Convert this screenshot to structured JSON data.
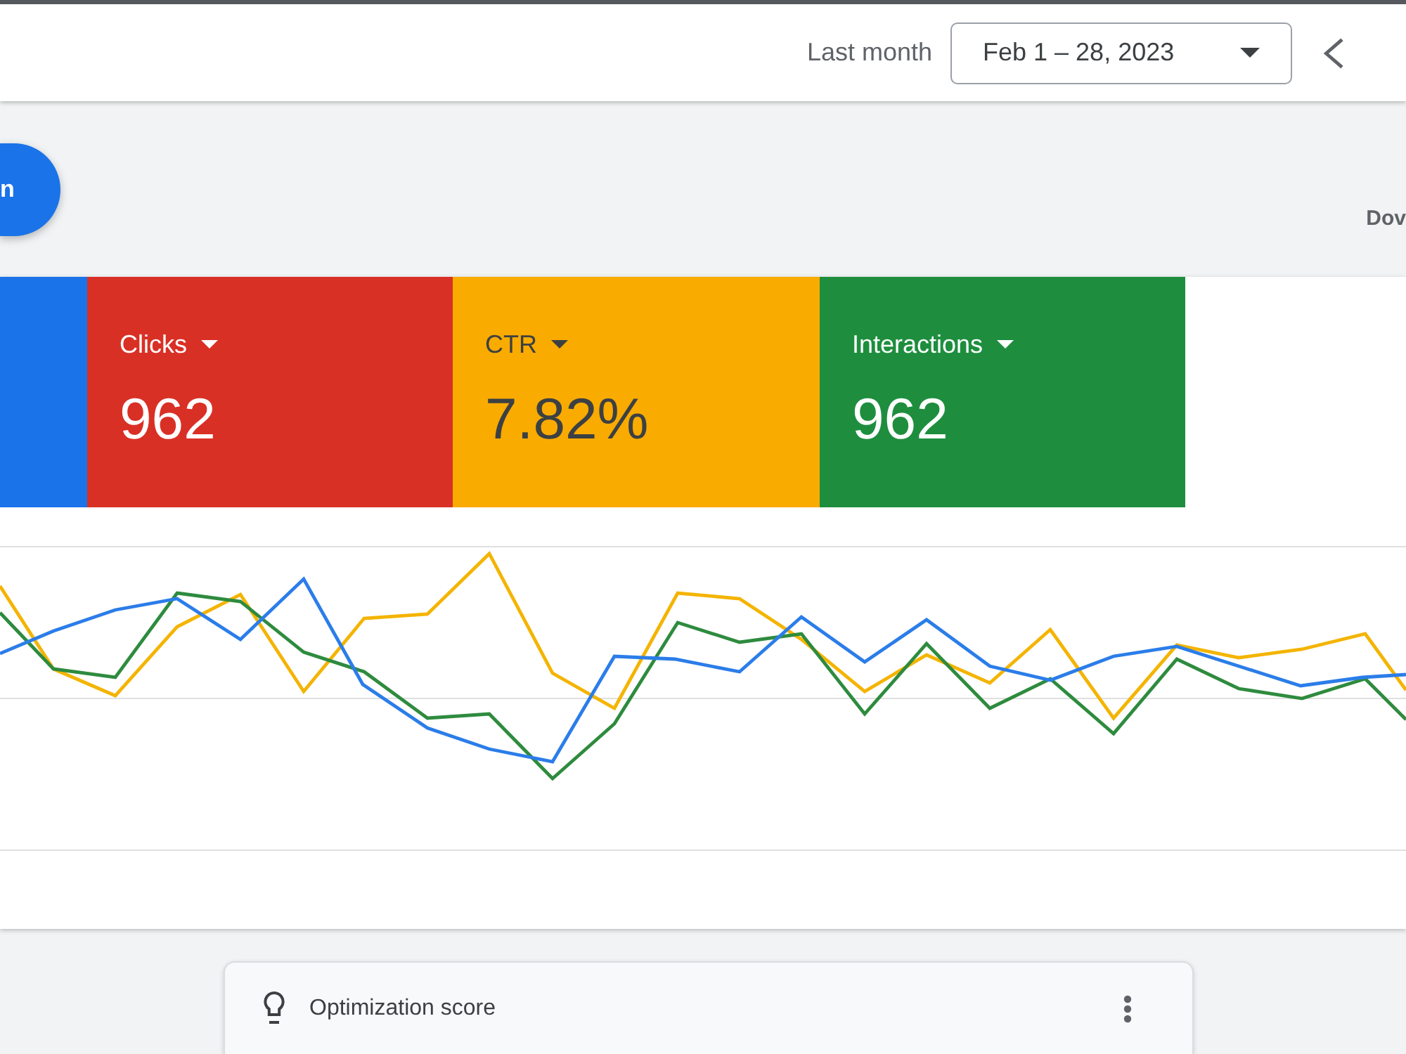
{
  "header": {
    "range_label": "Last month",
    "date_range": "Feb 1 – 28, 2023"
  },
  "toolbar": {
    "action_button": "n",
    "link": "Dov"
  },
  "metrics": [
    {
      "color": "#1a73e8"
    },
    {
      "label": "Clicks",
      "value": "962",
      "color": "#d93025"
    },
    {
      "label": "CTR",
      "value": "7.82%",
      "color": "#f9ab00"
    },
    {
      "label": "Interactions",
      "value": "962",
      "color": "#1e8e3e"
    }
  ],
  "cards": [
    {
      "title": "Optimization score"
    }
  ]
}
